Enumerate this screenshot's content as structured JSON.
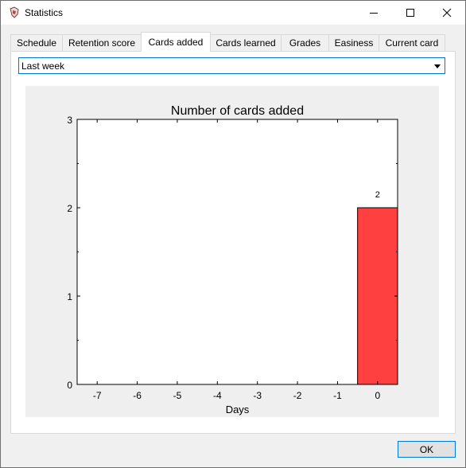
{
  "window": {
    "title": "Statistics",
    "icon": "mnemosyne-app-icon"
  },
  "tabs": [
    {
      "label": "Schedule",
      "active": false
    },
    {
      "label": "Retention score",
      "active": false
    },
    {
      "label": "Cards added",
      "active": true
    },
    {
      "label": "Cards learned",
      "active": false
    },
    {
      "label": "Grades",
      "active": false
    },
    {
      "label": "Easiness",
      "active": false
    },
    {
      "label": "Current card",
      "active": false
    }
  ],
  "period_select": {
    "value": "Last week"
  },
  "chart_data": {
    "type": "bar",
    "title": "Number of cards added",
    "xlabel": "Days",
    "ylabel": "",
    "categories": [
      "-7",
      "-6",
      "-5",
      "-4",
      "-3",
      "-2",
      "-1",
      "0"
    ],
    "values": [
      0,
      0,
      0,
      0,
      0,
      0,
      0,
      2
    ],
    "bar_labels": [
      "",
      "",
      "",
      "",
      "",
      "",
      "",
      "2"
    ],
    "xlim": [
      -7.5,
      0.5
    ],
    "ylim": [
      0,
      3
    ],
    "yticks": [
      "0",
      "1",
      "2",
      "3"
    ],
    "bar_color": "#ff4040",
    "background_color": "#efefef",
    "grid": false,
    "legend": "none"
  },
  "footer": {
    "ok_label": "OK"
  }
}
